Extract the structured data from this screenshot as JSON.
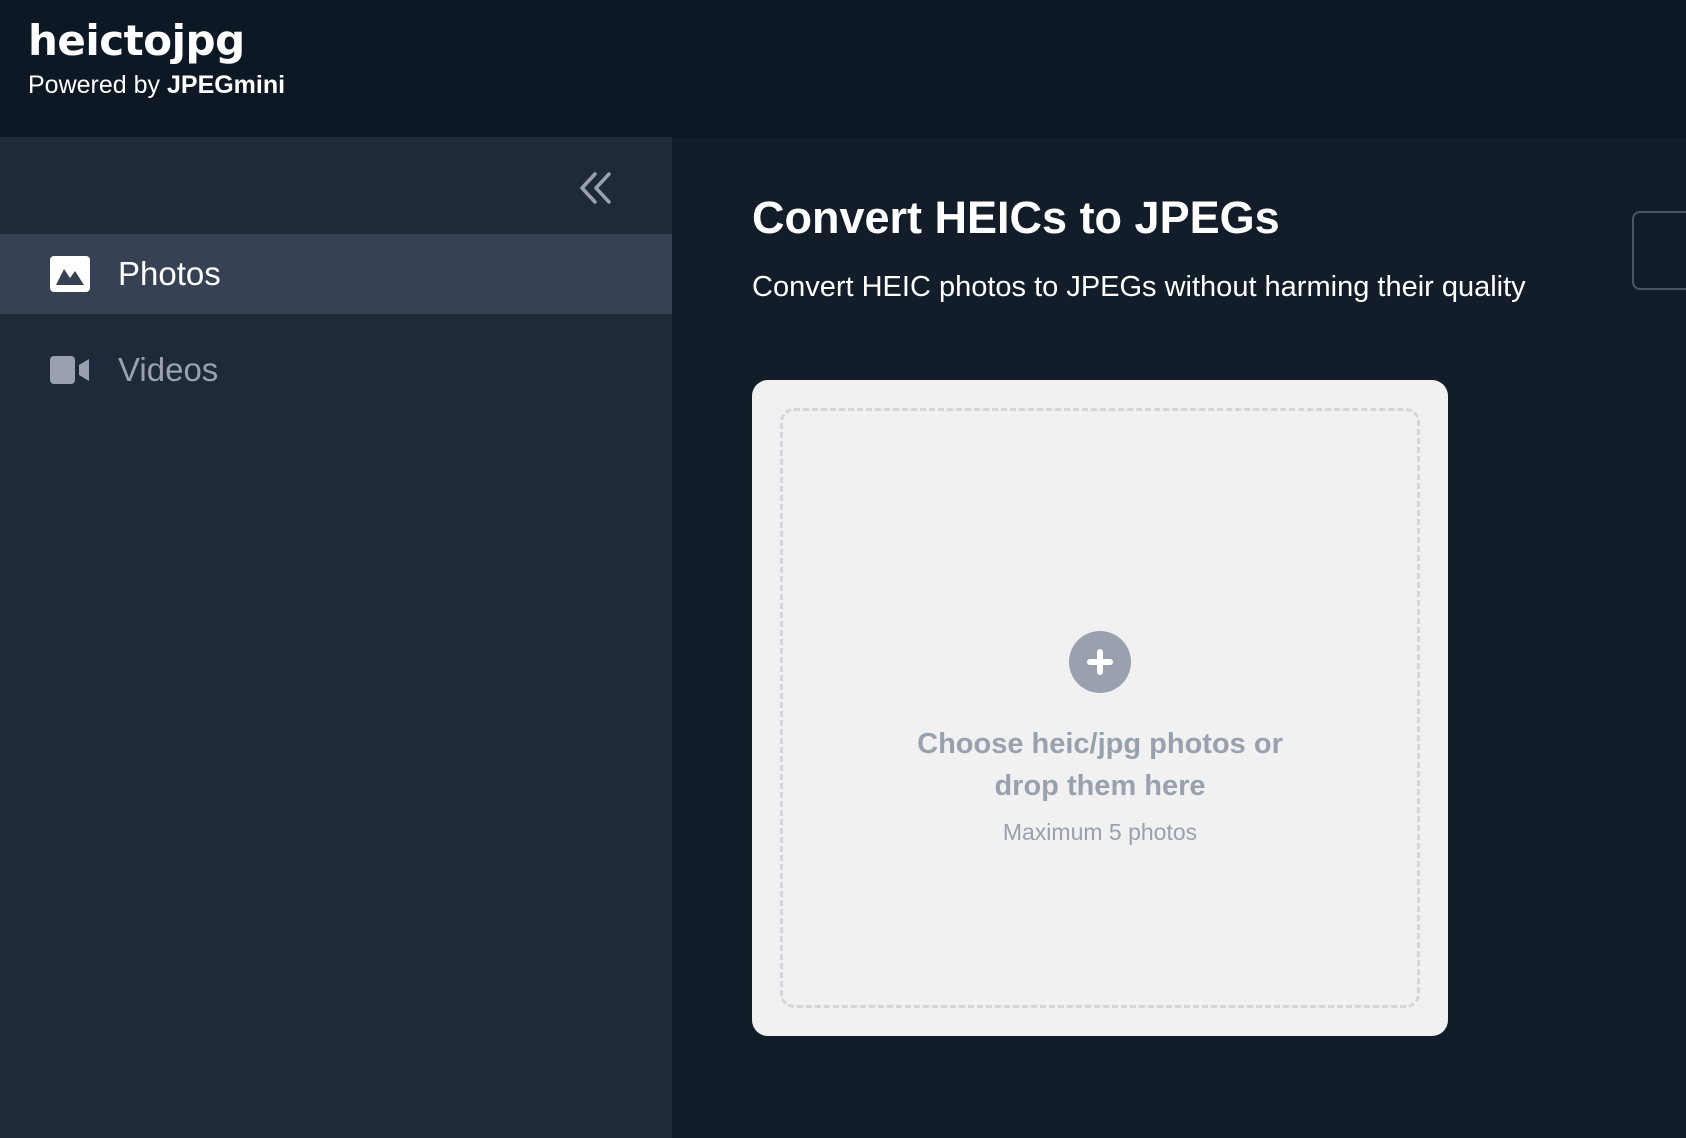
{
  "header": {
    "brand": "heictojpg",
    "powered_prefix": "Powered by",
    "powered_brand": "JPEGmini"
  },
  "sidebar": {
    "collapse_icon": "double-chevron-left-icon",
    "items": [
      {
        "label": "Photos",
        "icon": "image-icon",
        "active": true
      },
      {
        "label": "Videos",
        "icon": "video-camera-icon",
        "active": false
      }
    ]
  },
  "main": {
    "title": "Convert HEICs to JPEGs",
    "subtitle": "Convert HEIC photos to JPEGs without harming their quality",
    "upload": {
      "icon": "plus-circle-icon",
      "prompt": "Choose heic/jpg photos or drop them here",
      "limit": "Maximum 5 photos"
    }
  },
  "colors": {
    "header_bg": "#0e1824",
    "sidebar_bg": "#1e2939",
    "sidebar_active_bg": "#364153",
    "main_bg": "#131d2a",
    "card_bg": "#f1f1f1",
    "muted_text": "#99a1af"
  }
}
